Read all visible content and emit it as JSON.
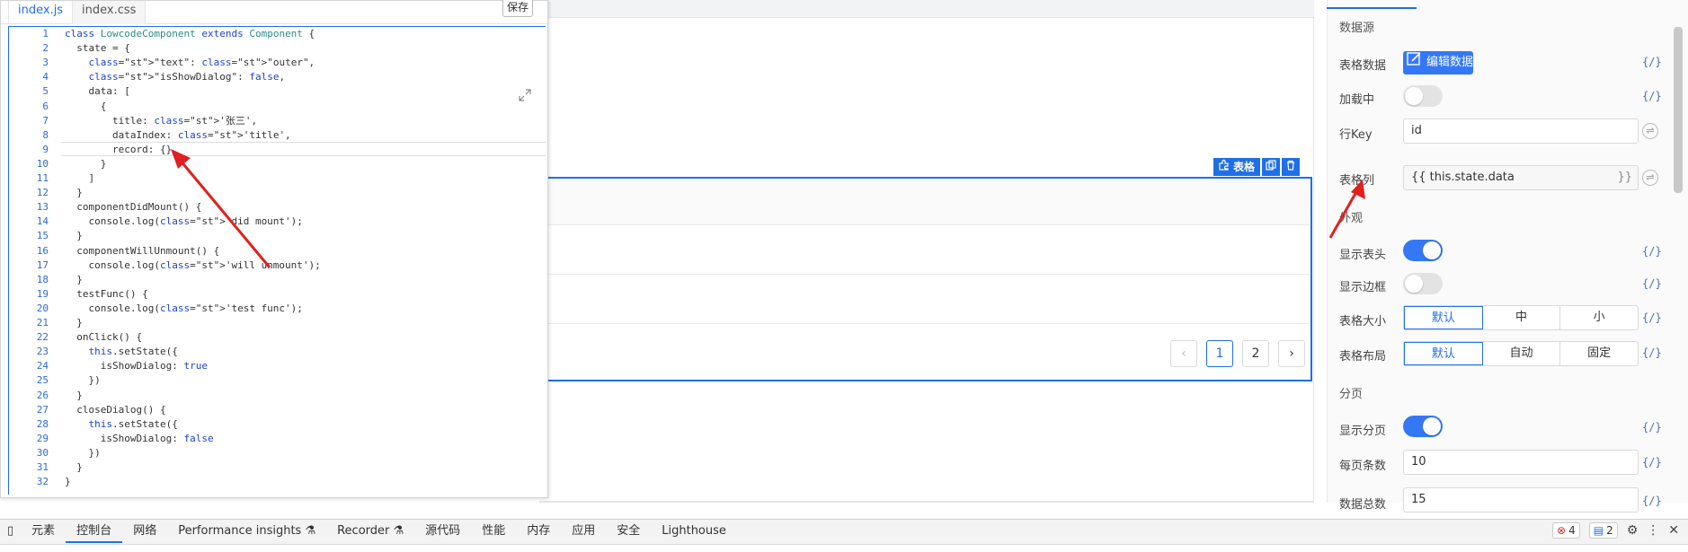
{
  "editor": {
    "tabs": [
      "index.js",
      "index.css"
    ],
    "save_label": "保存",
    "line_numbers": [
      "1",
      "2",
      "3",
      "4",
      "5",
      "6",
      "7",
      "8",
      "9",
      "10",
      "11",
      "12",
      "13",
      "14",
      "15",
      "16",
      "17",
      "18",
      "19",
      "20",
      "21",
      "22",
      "23",
      "24",
      "25",
      "26",
      "27",
      "28",
      "29",
      "30",
      "31",
      "32"
    ],
    "lines": [
      "class LowcodeComponent extends Component {",
      "  state = {",
      "    \"text\": \"outer\",",
      "    \"isShowDialog\": false,",
      "    data: [",
      "      {",
      "        title: '张三',",
      "        dataIndex: 'title',",
      "        record: {}",
      "      }",
      "    ]",
      "  }",
      "  componentDidMount() {",
      "    console.log('did mount');",
      "  }",
      "  componentWillUnmount() {",
      "    console.log('will unmount');",
      "  }",
      "  testFunc() {",
      "    console.log('test func');",
      "  }",
      "  onClick() {",
      "    this.setState({",
      "      isShowDialog: true",
      "    })",
      "  }",
      "  closeDialog() {",
      "    this.setState({",
      "      isShowDialog: false",
      "    })",
      "  }",
      "}"
    ]
  },
  "canvas": {
    "table_toolbar_label": "表格",
    "pagination": [
      "1",
      "2"
    ],
    "prev_icon": "chevron-left-icon",
    "next_icon": "chevron-right-icon"
  },
  "panel": {
    "section_datasource": "数据源",
    "table_data_label": "表格数据",
    "edit_data_button": "编辑数据",
    "loading_label": "加载中",
    "row_key_label": "行Key",
    "row_key_value": "id",
    "columns_label": "表格列",
    "columns_value": "{{ this.state.data",
    "columns_suffix": "}}",
    "section_appearance": "外观",
    "show_header_label": "显示表头",
    "show_border_label": "显示边框",
    "size_label": "表格大小",
    "size_options": [
      "默认",
      "中",
      "小"
    ],
    "layout_label": "表格布局",
    "layout_options": [
      "默认",
      "自动",
      "固定"
    ],
    "section_pagination": "分页",
    "show_pagination_label": "显示分页",
    "page_size_label": "每页条数",
    "page_size_value": "10",
    "total_label": "数据总数",
    "total_value": "15",
    "var_icon": "{/}",
    "toggles": {
      "loading": false,
      "show_header": true,
      "show_border": false,
      "show_pagination": true
    },
    "accent_color": "#3478f6"
  },
  "devtools": {
    "tabs": [
      "元素",
      "控制台",
      "网络",
      "Performance insights",
      "Recorder",
      "源代码",
      "性能",
      "内存",
      "应用",
      "安全",
      "Lighthouse"
    ],
    "active_tab": "控制台",
    "errors": "4",
    "messages": "2"
  }
}
